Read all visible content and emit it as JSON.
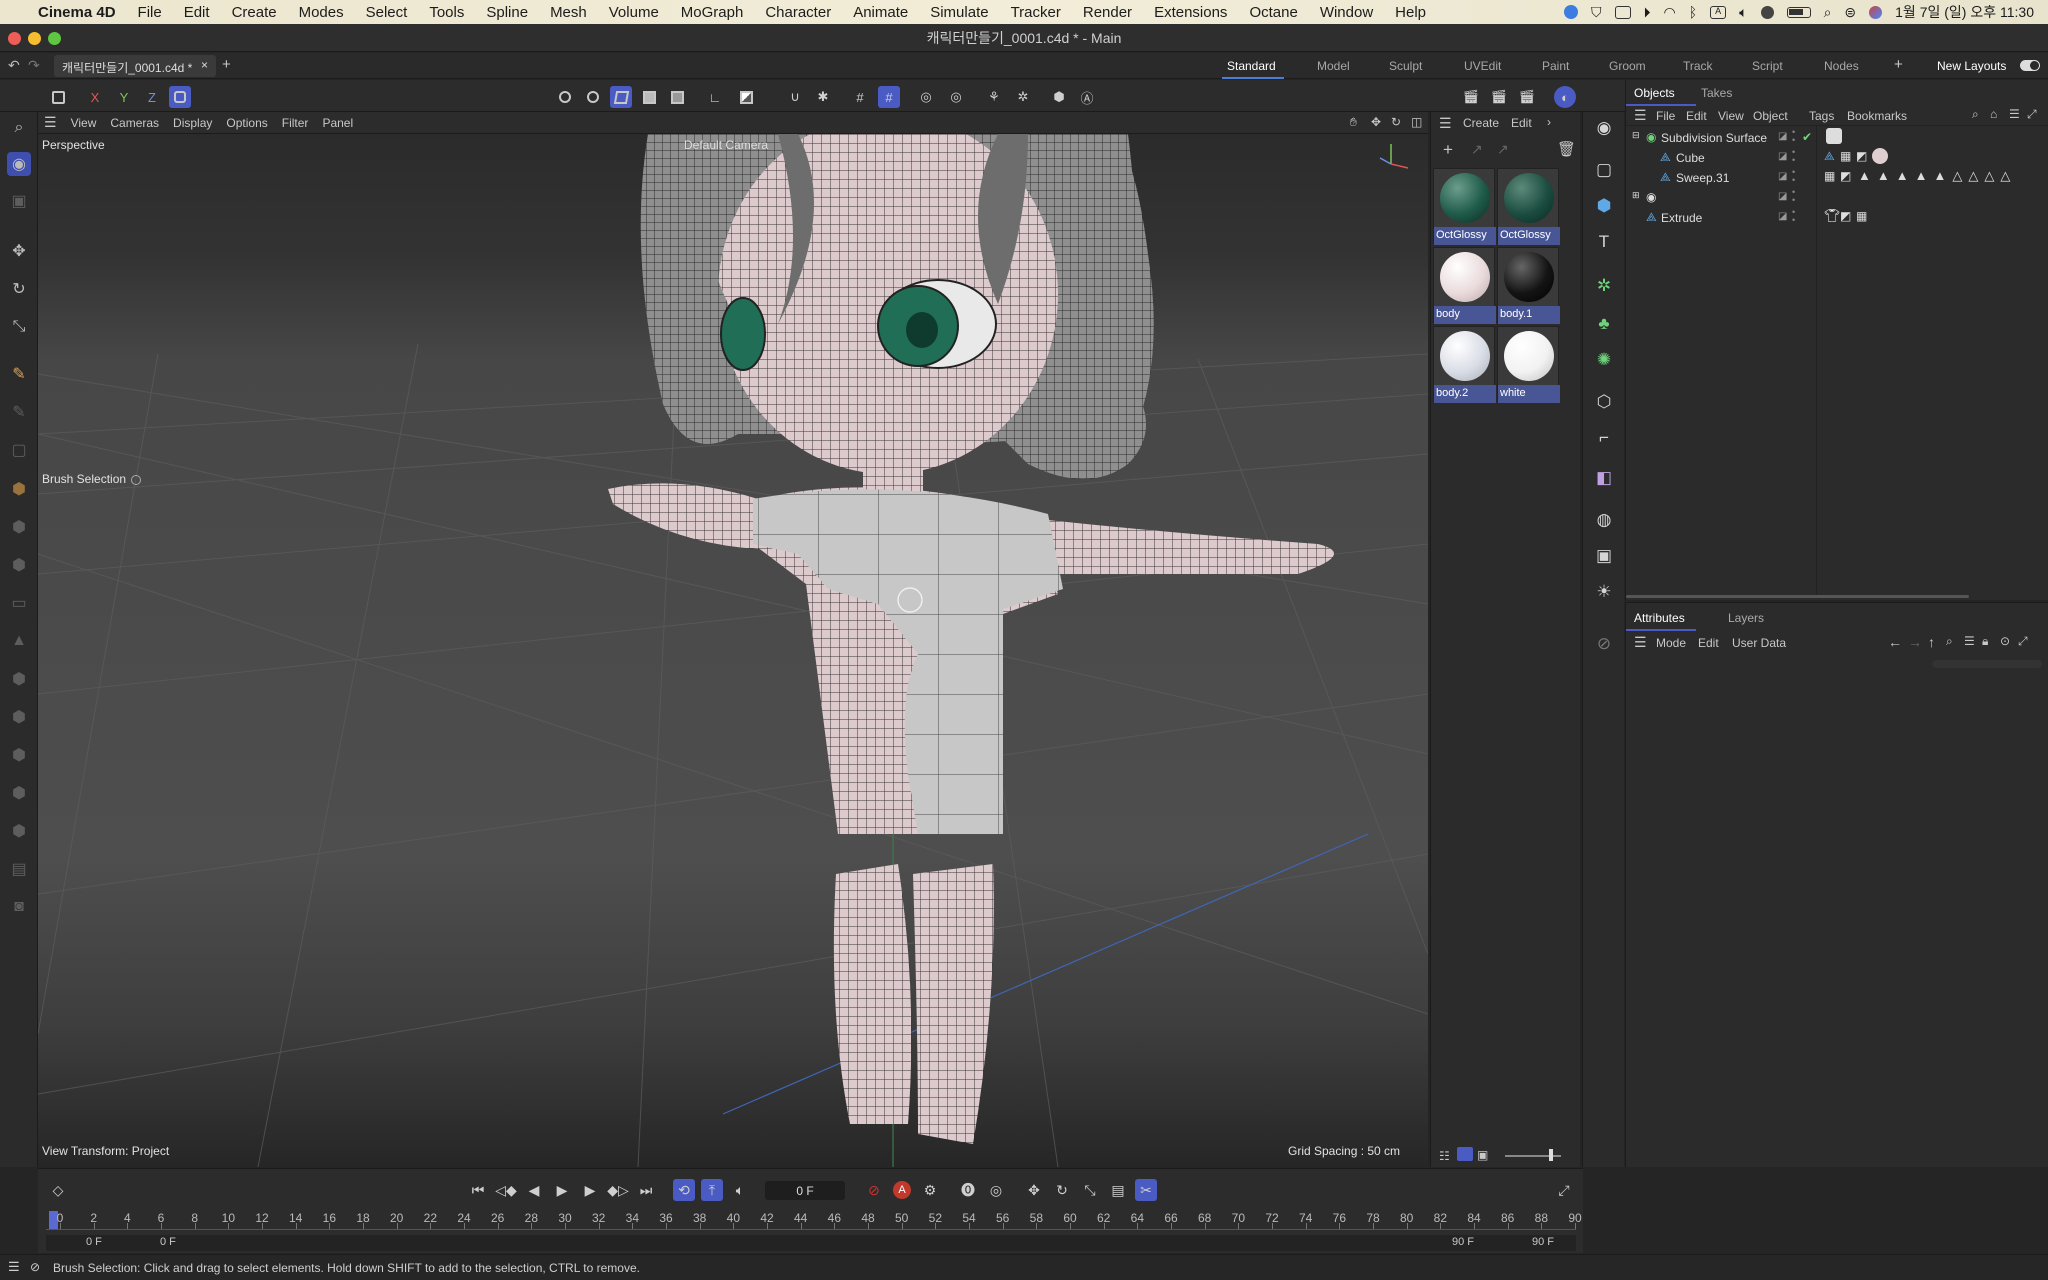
{
  "menubar": {
    "app": "Cinema 4D",
    "items": [
      "File",
      "Edit",
      "Create",
      "Modes",
      "Select",
      "Tools",
      "Spline",
      "Mesh",
      "Volume",
      "MoGraph",
      "Character",
      "Animate",
      "Simulate",
      "Tracker",
      "Render",
      "Extensions",
      "Octane",
      "Window",
      "Help"
    ],
    "clock": "1월 7일 (일) 오후 11:30"
  },
  "window": {
    "title": "캐릭터만들기_0001.c4d * - Main"
  },
  "tabs": {
    "document": "캐릭터만들기_0001.c4d *",
    "close": "×",
    "add": "+",
    "layouts": [
      "Standard",
      "Model",
      "Sculpt",
      "UVEdit",
      "Paint",
      "Groom",
      "Track",
      "Script",
      "Nodes"
    ],
    "active_layout": "Standard",
    "new_layouts": "New Layouts"
  },
  "toolbar": {
    "x": "X",
    "y": "Y",
    "z": "Z"
  },
  "viewport": {
    "menu": [
      "View",
      "Cameras",
      "Display",
      "Options",
      "Filter",
      "Panel"
    ],
    "label": "Perspective",
    "camera": "Default Camera",
    "tool_label": "Brush Selection",
    "view_transform": "View Transform: Project",
    "grid_spacing": "Grid Spacing : 50 cm"
  },
  "materials": {
    "menu": [
      "Create",
      "Edit"
    ],
    "items": [
      {
        "name": "OctGlossy",
        "color": "#1f5b4a"
      },
      {
        "name": "OctGlossy",
        "color": "#1b4d40"
      },
      {
        "name": "body",
        "color": "#eadbdc"
      },
      {
        "name": "body.1",
        "color": "#141414"
      },
      {
        "name": "body.2",
        "color": "#d9dde6"
      },
      {
        "name": "white",
        "color": "#f2f2f2"
      }
    ]
  },
  "objects": {
    "tabs": [
      "Objects",
      "Takes"
    ],
    "menu": [
      "File",
      "Edit",
      "View",
      "Object",
      "Tags",
      "Bookmarks"
    ],
    "items": [
      "Subdivision Surface",
      "Cube",
      "Sweep.31",
      "",
      "Extrude"
    ]
  },
  "attributes": {
    "tabs": [
      "Attributes",
      "Layers"
    ],
    "menu": [
      "Mode",
      "Edit",
      "User Data"
    ]
  },
  "timeline": {
    "current_frame": "0 F",
    "start": "0 F",
    "start2": "0 F",
    "end": "90 F",
    "end2": "90 F",
    "ticks": [
      "0",
      "2",
      "4",
      "6",
      "8",
      "10",
      "12",
      "14",
      "16",
      "18",
      "20",
      "22",
      "24",
      "26",
      "28",
      "30",
      "32",
      "34",
      "36",
      "38",
      "40",
      "42",
      "44",
      "46",
      "48",
      "50",
      "52",
      "54",
      "56",
      "58",
      "60",
      "62",
      "64",
      "66",
      "68",
      "70",
      "72",
      "74",
      "76",
      "78",
      "80",
      "82",
      "84",
      "86",
      "88",
      "90"
    ]
  },
  "status": {
    "text": "Brush Selection: Click and drag to select elements. Hold down SHIFT to add to the selection, CTRL to remove."
  },
  "colors": {
    "accent": "#4a5bc4",
    "mesh": "#d8c7c9",
    "hair": "#8a8a8a",
    "eye": "#1f6e55",
    "axis_blue": "#3f66b5"
  }
}
